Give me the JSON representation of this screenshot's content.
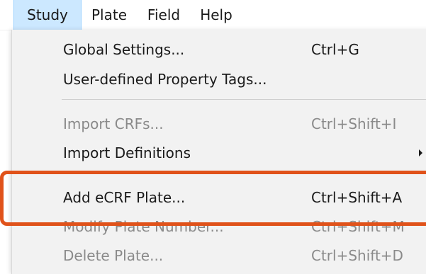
{
  "menubar": {
    "items": [
      {
        "label": "Study",
        "active": true
      },
      {
        "label": "Plate",
        "active": false
      },
      {
        "label": "Field",
        "active": false
      },
      {
        "label": "Help",
        "active": false
      }
    ]
  },
  "study_menu": {
    "items": [
      {
        "label": "Global Settings...",
        "shortcut": "Ctrl+G",
        "enabled": true
      },
      {
        "label": "User-defined Property Tags...",
        "shortcut": "",
        "enabled": true
      },
      {
        "label": "Import CRFs...",
        "shortcut": "Ctrl+Shift+I",
        "enabled": false
      },
      {
        "label": "Import Definitions",
        "shortcut": "",
        "enabled": true,
        "submenu": true
      },
      {
        "label": "Add eCRF Plate...",
        "shortcut": "Ctrl+Shift+A",
        "enabled": true,
        "highlighted": true
      },
      {
        "label": "Modify Plate Number...",
        "shortcut": "Ctrl+Shift+M",
        "enabled": false
      },
      {
        "label": "Delete Plate...",
        "shortcut": "Ctrl+Shift+D",
        "enabled": false
      }
    ]
  },
  "annotation": {
    "color": "#e0521a",
    "target": "Add eCRF Plate..."
  }
}
